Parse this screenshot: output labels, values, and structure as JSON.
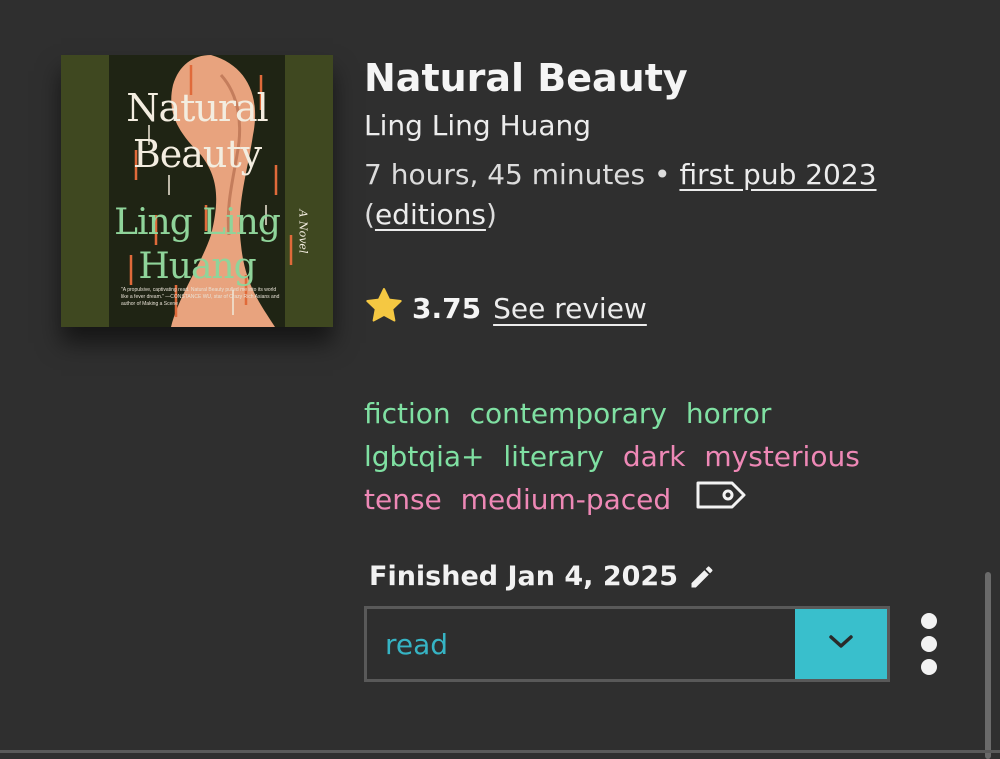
{
  "book": {
    "title": "Natural Beauty",
    "author": "Ling Ling Huang",
    "duration": "7 hours, 45 minutes",
    "separator": " • ",
    "first_pub": "first pub 2023",
    "editions_open": "(",
    "editions": "editions",
    "editions_close": ")"
  },
  "cover": {
    "title_line1": "Natural",
    "title_line2": "Beauty",
    "subtitle": "A Novel",
    "author_line1": "Ling Ling",
    "author_line2": "Huang",
    "blurb": "\"A propulsive, captivating read. Natural Beauty pulled me into its world like a fever dream.\" —CONSTANCE WU, star of Crazy Rich Asians and author of Making a Scene",
    "bg_color": "#3f4820"
  },
  "rating": {
    "value": "3.75",
    "review_link": "See review",
    "icon": "star-icon",
    "star_color": "#f5c842"
  },
  "tags": [
    {
      "label": "fiction",
      "kind": "genre"
    },
    {
      "label": "contemporary",
      "kind": "genre"
    },
    {
      "label": "horror",
      "kind": "genre"
    },
    {
      "label": "lgbtqia+",
      "kind": "genre"
    },
    {
      "label": "literary",
      "kind": "genre"
    },
    {
      "label": "dark",
      "kind": "mood"
    },
    {
      "label": "mysterious",
      "kind": "mood"
    },
    {
      "label": "tense",
      "kind": "mood"
    },
    {
      "label": "medium-paced",
      "kind": "pace"
    }
  ],
  "tag_icon": "tag-icon",
  "colors": {
    "genre": "#7fe0a2",
    "mood": "#ee88b6",
    "accent": "#39bfcc",
    "background": "#2f2f2f"
  },
  "reading": {
    "finished_label": "Finished Jan 4, 2025",
    "edit_icon": "pencil-icon",
    "status": "read",
    "dropdown_icon": "chevron-down-icon",
    "more_icon": "kebab-menu-icon"
  }
}
